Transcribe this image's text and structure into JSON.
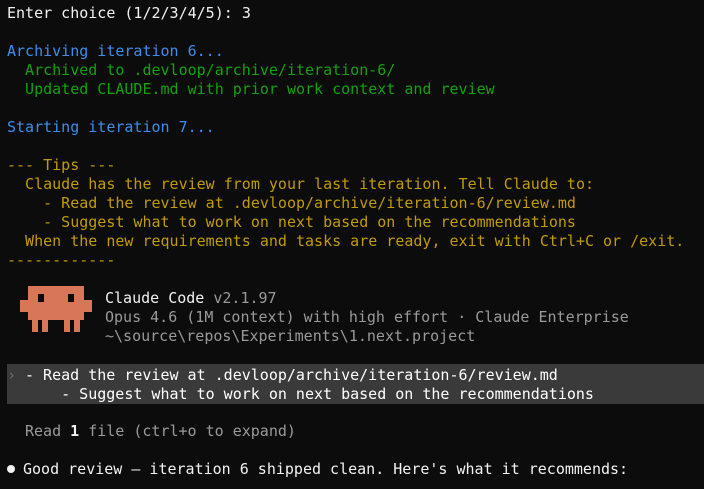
{
  "choice_prompt": {
    "label": "Enter choice (1/2/3/4/5): ",
    "value": "3"
  },
  "archive": {
    "heading": "Archiving iteration 6...",
    "archived": "  Archived to .devloop/archive/iteration-6/",
    "updated": "  Updated CLAUDE.md with prior work context and review"
  },
  "starting": "Starting iteration 7...",
  "tips": {
    "header": "--- Tips ---",
    "intro": "  Claude has the review from your last iteration. Tell Claude to:",
    "step1": "    - Read the review at .devloop/archive/iteration-6/review.md",
    "step2": "    - Suggest what to work on next based on the recommendations",
    "outro": "  When the new requirements and tasks are ready, exit with Ctrl+C or /exit.",
    "footer": "------------"
  },
  "banner": {
    "app_name": "Claude Code",
    "version": "v2.1.97",
    "model_line": "Opus 4.6 (1M context) with high effort · Claude Enterprise",
    "path": "~\\source\\repos\\Experiments\\1.next.project"
  },
  "prompt": {
    "caret": "›",
    "line1": "- Read the review at .devloop/archive/iteration-6/review.md",
    "line2": "    - Suggest what to work on next based on the recommendations"
  },
  "tool_result": {
    "prefix": "Read ",
    "count": "1",
    "suffix": " file (ctrl+o to expand)"
  },
  "reply": "Good review — iteration 6 shipped clean. Here's what it recommends:",
  "colors": {
    "background": "#0c0c0c",
    "blue": "#3b8eea",
    "green": "#13a10e",
    "gold": "#c19c00",
    "mascot": "#d77757"
  }
}
